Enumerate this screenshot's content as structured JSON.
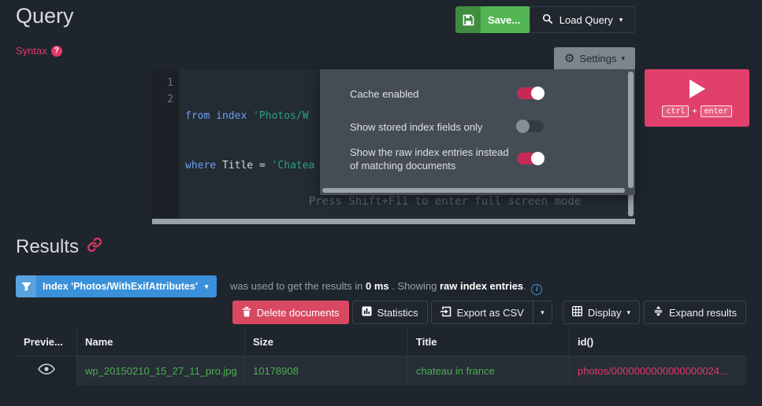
{
  "colors": {
    "accent_pink": "#e3386a",
    "success_green": "#53b553",
    "info_blue": "#3a90d9",
    "link_green": "#4caf50",
    "danger_red": "#d84961"
  },
  "icons": {
    "caret": "▾",
    "gear": "⚙"
  },
  "header": {
    "title": "Query",
    "save_label": "Save...",
    "load_query_label": "Load Query"
  },
  "syntax_help": {
    "label": "Syntax",
    "icon_glyph": "?"
  },
  "settings": {
    "button_label": "Settings",
    "items": [
      {
        "label": "Cache enabled",
        "enabled": true
      },
      {
        "label": "Show stored index fields only",
        "enabled": false
      },
      {
        "label": "Show the raw index entries instead of matching documents",
        "enabled": true
      }
    ]
  },
  "editor": {
    "line1": {
      "number": "1",
      "keyword": "from index ",
      "string": "'Photos/W"
    },
    "line2": {
      "number": "2",
      "keyword": "where ",
      "identifier": "Title ",
      "operator": "= ",
      "string": "'Chatea"
    },
    "fullscreen_hint": "Press Shift+F11 to enter full screen mode"
  },
  "run": {
    "key1": "ctrl",
    "plus": "+",
    "key2": "enter"
  },
  "results": {
    "title": "Results",
    "index_button_label": "Index 'Photos/WithExifAttributes'",
    "info_text_1": "was used to get the results in ",
    "info_time": "0 ms",
    "info_text_2": " . Showing ",
    "info_highlight": "raw index entries",
    "info_text_3": ". ",
    "info_icon_glyph": "i"
  },
  "toolbar": {
    "delete_label": "Delete documents",
    "statistics_label": "Statistics",
    "export_label": "Export as CSV",
    "display_label": "Display",
    "expand_label": "Expand results"
  },
  "table": {
    "headers": [
      "Previe...",
      "Name",
      "Size",
      "Title",
      "id()"
    ],
    "rows": [
      {
        "name": "wp_20150210_15_27_11_pro.jpg",
        "size": "10178908",
        "title": "chateau in france",
        "id": "photos/0000000000000000024..."
      }
    ]
  }
}
